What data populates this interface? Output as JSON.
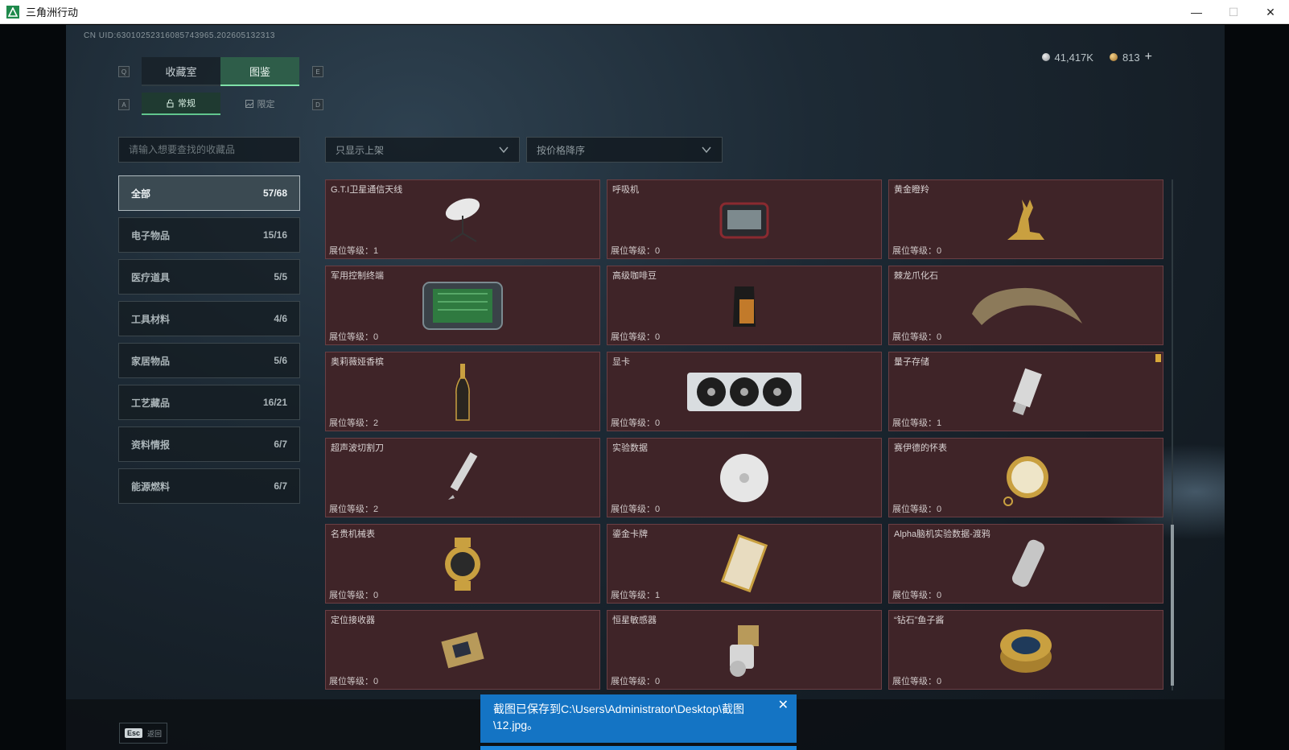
{
  "window": {
    "title": "三角洲行动",
    "minimize": "—",
    "maximize": "☐",
    "close": "✕"
  },
  "uid": "CN UID:63010252316085743965.202605132313",
  "currency": {
    "silver": "41,417K",
    "gold": "813",
    "add": "+"
  },
  "keyhints": {
    "tab_left": "Q",
    "tab_right": "E",
    "sub_left": "A",
    "sub_right": "D"
  },
  "main_tabs": [
    {
      "label": "收藏室"
    },
    {
      "label": "图鉴"
    }
  ],
  "sub_tabs": [
    {
      "label": "常规"
    },
    {
      "label": "限定"
    }
  ],
  "search": {
    "placeholder": "请输入想要查找的收藏品"
  },
  "filters": {
    "shelf": "只显示上架",
    "sort": "按价格降序"
  },
  "categories": [
    {
      "label": "全部",
      "count": "57/68"
    },
    {
      "label": "电子物品",
      "count": "15/16"
    },
    {
      "label": "医疗道具",
      "count": "5/5"
    },
    {
      "label": "工具材料",
      "count": "4/6"
    },
    {
      "label": "家居物品",
      "count": "5/6"
    },
    {
      "label": "工艺藏品",
      "count": "16/21"
    },
    {
      "label": "资料情报",
      "count": "6/7"
    },
    {
      "label": "能源燃料",
      "count": "6/7"
    }
  ],
  "items": [
    {
      "name": "G.T.I卫星通信天线",
      "level": "展位等级：1",
      "icon": "satellite-dish-icon"
    },
    {
      "name": "呼吸机",
      "level": "展位等级：0",
      "icon": "ventilator-icon"
    },
    {
      "name": "黄金瞪羚",
      "level": "展位等级：0",
      "icon": "golden-gazelle-icon"
    },
    {
      "name": "军用控制终端",
      "level": "展位等级：0",
      "icon": "control-terminal-icon"
    },
    {
      "name": "高级咖啡豆",
      "level": "展位等级：0",
      "icon": "coffee-bag-icon"
    },
    {
      "name": "棘龙爪化石",
      "level": "展位等级：0",
      "icon": "claw-fossil-icon"
    },
    {
      "name": "奥莉薇娅香槟",
      "level": "展位等级：2",
      "icon": "champagne-icon"
    },
    {
      "name": "显卡",
      "level": "展位等级：0",
      "icon": "graphics-card-icon"
    },
    {
      "name": "量子存储",
      "level": "展位等级：1",
      "icon": "usb-drive-icon"
    },
    {
      "name": "超声波切割刀",
      "level": "展位等级：2",
      "icon": "ultrasonic-cutter-icon"
    },
    {
      "name": "实验数据",
      "level": "展位等级：0",
      "icon": "disc-icon"
    },
    {
      "name": "赛伊德的怀表",
      "level": "展位等级：0",
      "icon": "pocket-watch-icon"
    },
    {
      "name": "名贵机械表",
      "level": "展位等级：0",
      "icon": "wristwatch-icon"
    },
    {
      "name": "鎏金卡牌",
      "level": "展位等级：1",
      "icon": "gilded-card-icon"
    },
    {
      "name": "Alpha脑机实验数据-渡鸦",
      "level": "展位等级：0",
      "icon": "data-capsule-icon"
    },
    {
      "name": "定位接收器",
      "level": "展位等级：0",
      "icon": "receiver-icon"
    },
    {
      "name": "恒星敏感器",
      "level": "展位等级：0",
      "icon": "star-sensor-icon"
    },
    {
      "name": "“钻石”鱼子酱",
      "level": "展位等级：0",
      "icon": "caviar-tin-icon"
    }
  ],
  "footer": {
    "esc_key": "Esc",
    "back": "返回"
  },
  "toast": {
    "message": "截图已保存到C:\\Users\\Administrator\\Desktop\\截图\\12.jpg。",
    "close": "✕"
  },
  "colors": {
    "accent": "#7fe0a8",
    "card_bg": "#3f2428",
    "toast": "#1474c4"
  }
}
